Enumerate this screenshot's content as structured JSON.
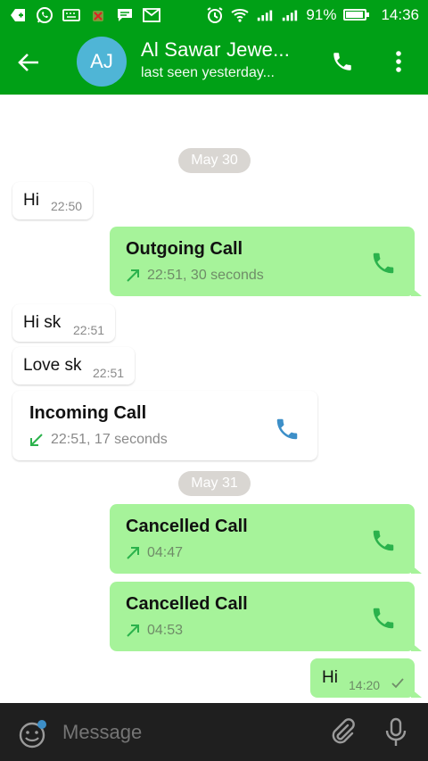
{
  "status_bar": {
    "battery": "91%",
    "time": "14:36",
    "battery_level": 0.91
  },
  "header": {
    "avatar_initials": "AJ",
    "title": "Al Sawar Jewe...",
    "subtitle": "last seen yesterday..."
  },
  "chat": {
    "date_1": "May 30",
    "msg_hi": {
      "text": "Hi",
      "time": "22:50"
    },
    "outgoing_call": {
      "title": "Outgoing Call",
      "detail": "22:51, 30 seconds"
    },
    "msg_hisk": {
      "text": "Hi sk",
      "time": "22:51"
    },
    "msg_lovesk": {
      "text": "Love sk",
      "time": "22:51"
    },
    "incoming_call": {
      "title": "Incoming Call",
      "detail": "22:51, 17 seconds"
    },
    "date_2": "May 31",
    "cancelled_1": {
      "title": "Cancelled Call",
      "detail": "04:47"
    },
    "cancelled_2": {
      "title": "Cancelled Call",
      "detail": "04:53"
    },
    "msg_hi_out": {
      "text": "Hi",
      "time": "14:20"
    }
  },
  "input": {
    "placeholder": "Message"
  },
  "colors": {
    "brand_green": "#00a016",
    "bubble_out": "#a6f39a",
    "call_icon_green": "#2bb24c",
    "call_icon_blue": "#3d8fc8"
  }
}
